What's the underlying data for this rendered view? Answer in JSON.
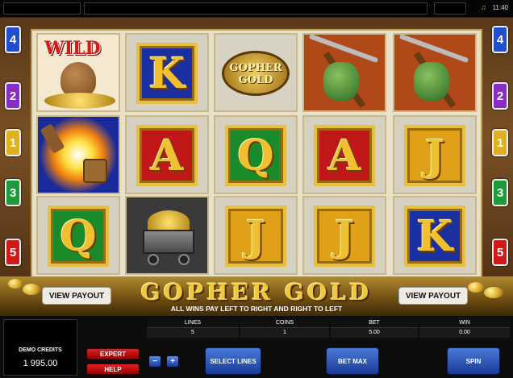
{
  "topbar": {
    "time": "11:40"
  },
  "paylines_left": [
    "4",
    "2",
    "1",
    "3",
    "5"
  ],
  "paylines_right": [
    "4",
    "2",
    "1",
    "3",
    "5"
  ],
  "line_colors": {
    "4": "#1f4fcf",
    "2": "#8a2cc8",
    "1": "#e0b020",
    "3": "#1e9a3a",
    "5": "#d01a1a"
  },
  "reels": [
    [
      {
        "symbol": "wild",
        "label": "WILD"
      },
      {
        "symbol": "dynamite",
        "label": ""
      },
      {
        "symbol": "Q",
        "label": "Q",
        "bg": "#1a8a2a"
      }
    ],
    [
      {
        "symbol": "K",
        "label": "K",
        "bg": "#1a30a0"
      },
      {
        "symbol": "A",
        "label": "A",
        "bg": "#c01818"
      },
      {
        "symbol": "minecart",
        "label": ""
      }
    ],
    [
      {
        "symbol": "gopher-gold-logo",
        "label": "GOPHER GOLD"
      },
      {
        "symbol": "Q",
        "label": "Q",
        "bg": "#1a8a2a"
      },
      {
        "symbol": "J",
        "label": "J",
        "bg": "#e0a018"
      }
    ],
    [
      {
        "symbol": "pickaxe",
        "label": ""
      },
      {
        "symbol": "A",
        "label": "A",
        "bg": "#c01818"
      },
      {
        "symbol": "J",
        "label": "J",
        "bg": "#e0a018"
      }
    ],
    [
      {
        "symbol": "pickaxe",
        "label": ""
      },
      {
        "symbol": "J",
        "label": "J",
        "bg": "#e0a018"
      },
      {
        "symbol": "K",
        "label": "K",
        "bg": "#1a30a0"
      }
    ]
  ],
  "banner": {
    "title": "GOPHER GOLD",
    "subtitle": "ALL WINS PAY LEFT TO RIGHT AND RIGHT TO LEFT",
    "view_payout_left": "VIEW PAYOUT",
    "view_payout_right": "VIEW PAYOUT"
  },
  "controls": {
    "credits_label": "DEMO CREDITS",
    "credits_value": "1 995.00",
    "expert": "EXPERT",
    "help": "HELP",
    "minus": "−",
    "plus": "+",
    "lines_label": "LINES",
    "lines_value": "5",
    "coins_label": "COINS",
    "coins_value": "1",
    "bet_label": "BET",
    "bet_value": "5.00",
    "win_label": "WIN",
    "win_value": "0.00",
    "select_lines": "SELECT LINES",
    "bet_max": "BET MAX",
    "spin": "SPIN"
  }
}
